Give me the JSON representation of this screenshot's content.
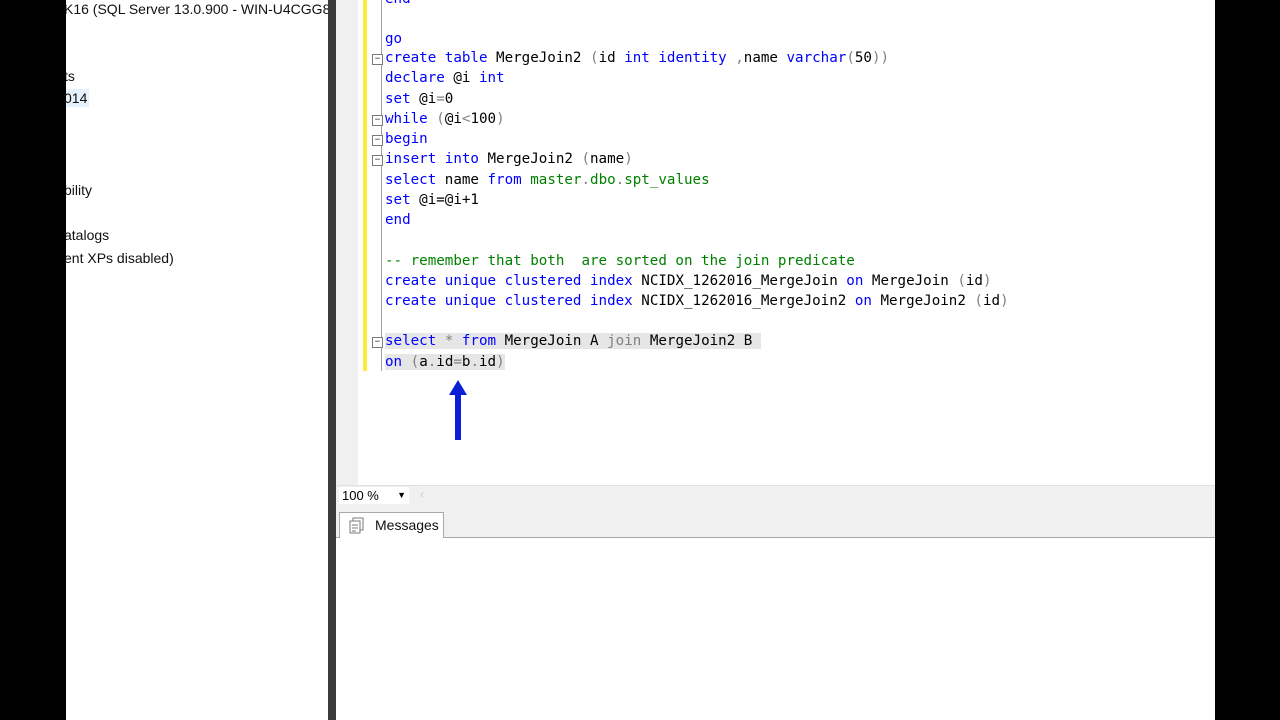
{
  "explorer": {
    "server_node": "K16 (SQL Server 13.0.900 - WIN-U4CGG8",
    "item_databases": "ts",
    "item_2014": "014",
    "item_availability": "bility",
    "item_catalogs": "atalogs",
    "item_xps": "ent XPs disabled)"
  },
  "editor": {
    "line_end_top": "end",
    "line_go": "go",
    "line_select_name": "name",
    "line_set_inc": "@i=@i+1",
    "line_end": "end",
    "comment": "-- remember that both  are sorted on the join predicate"
  },
  "toolbar": {
    "zoom_value": "100 %"
  },
  "results": {
    "tab_messages": "Messages"
  },
  "colors": {
    "keyword": "#0000ff",
    "function": "#ff00ff",
    "comment": "#008000",
    "operator": "#808080",
    "changed_marker": "#ffeb3b",
    "arrow": "#0a1fd6"
  }
}
